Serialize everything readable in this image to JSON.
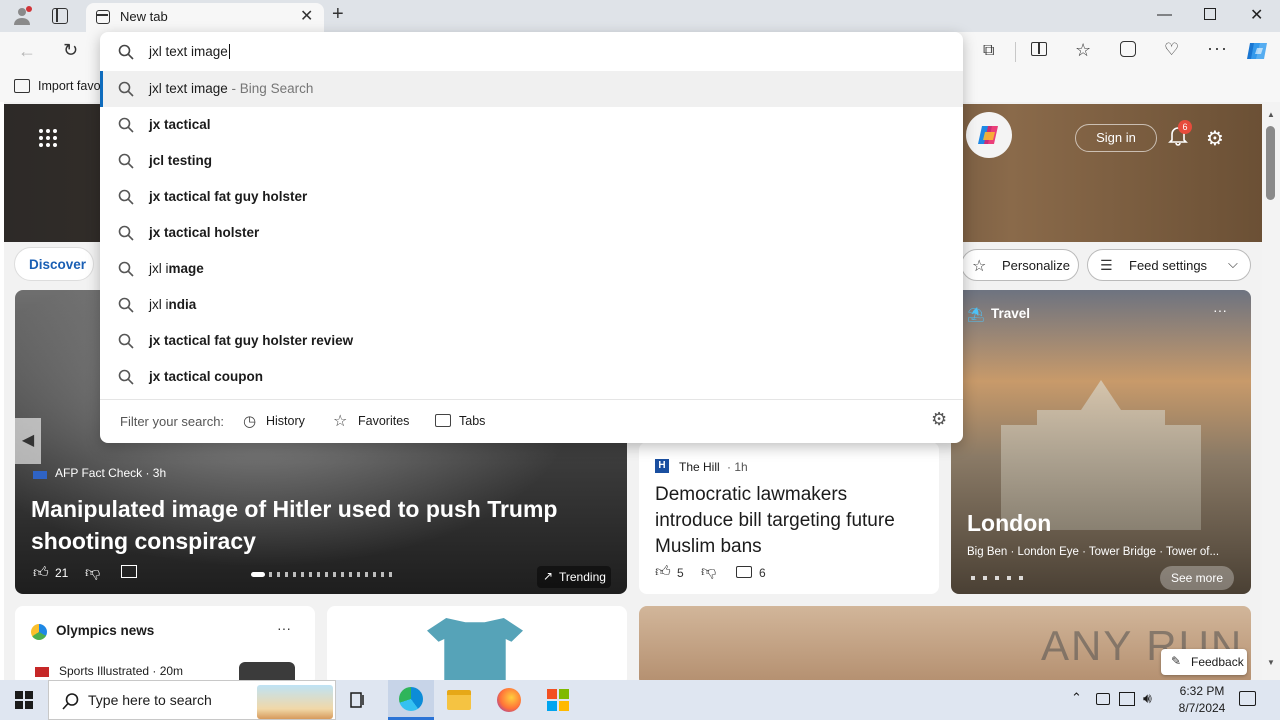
{
  "browser": {
    "tab_title": "New tab",
    "address_value": "jxl text image",
    "fav_import_label": "Import favo"
  },
  "suggestions": {
    "top": {
      "text": "jxl text image",
      "suffix": "- Bing Search"
    },
    "items": [
      {
        "prefix": "",
        "bold": "jx tactical"
      },
      {
        "prefix": "",
        "bold": "jcl testing"
      },
      {
        "prefix": "",
        "bold": "jx tactical fat guy holster"
      },
      {
        "prefix": "",
        "bold": "jx tactical holster"
      },
      {
        "prefix": "jxl i",
        "bold": "mage"
      },
      {
        "prefix": "jxl i",
        "bold": "ndia"
      },
      {
        "prefix": "",
        "bold": "jx tactical fat guy holster review"
      },
      {
        "prefix": "",
        "bold": "jx tactical coupon"
      }
    ],
    "filter_label": "Filter your search:",
    "filters": [
      "History",
      "Favorites",
      "Tabs"
    ]
  },
  "newtab": {
    "sign_in": "Sign in",
    "notif_count": "6",
    "discover": "Discover",
    "personalize": "Personalize",
    "feed_settings": "Feed settings"
  },
  "cards": {
    "hero": {
      "source": "AFP Fact Check · 3h",
      "headline": "Manipulated image of Hitler used to push Trump shooting conspiracy",
      "likes": "21",
      "trending": "Trending"
    },
    "hill": {
      "source": "The Hill",
      "age": "· 1h",
      "headline": "Democratic lawmakers introduce bill targeting future Muslim bans",
      "likes": "5",
      "comments": "6"
    },
    "travel": {
      "label": "Travel",
      "title": "London",
      "desc": "Big Ben · London Eye · Tower Bridge · Tower of...",
      "see_more": "See more"
    },
    "olympics": {
      "title": "Olympics news",
      "source": "Sports Illustrated · 20m"
    },
    "feedback": "Feedback",
    "watermark": "ANY RUN"
  },
  "taskbar": {
    "search_placeholder": "Type here to search",
    "time": "6:32 PM",
    "date": "8/7/2024"
  }
}
